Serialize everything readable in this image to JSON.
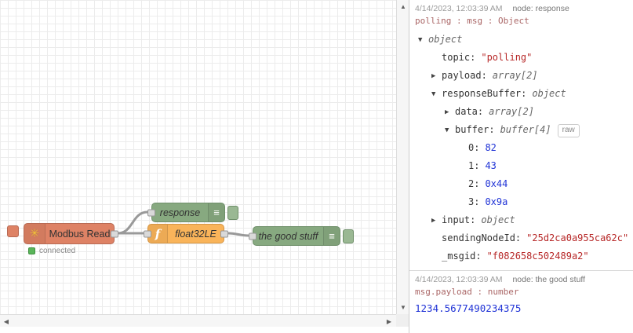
{
  "colors": {
    "modbus_node": "#de8265",
    "debug_node": "#87a980",
    "function_node": "#f9b45a",
    "string_value": "#b72828",
    "number_value": "#2033d6",
    "wire": "#999999"
  },
  "canvas": {
    "modbus": {
      "label": "Modbus Read",
      "status": "connected"
    },
    "response": {
      "label": "response"
    },
    "func": {
      "label": "float32LE",
      "icon": "f"
    },
    "good": {
      "label": "the good stuff"
    },
    "burger_icon": "≡",
    "gear_icon": "✳"
  },
  "debug": {
    "raw_button": "raw",
    "entry1": {
      "timestamp": "4/14/2023, 12:03:39 AM",
      "node": "node: response",
      "path": "polling : msg : Object",
      "rows": [
        {
          "indent": 0,
          "arrow": "▼",
          "key": "object",
          "key_class": "type"
        },
        {
          "indent": 1,
          "arrow": "",
          "key": "topic:",
          "value": "\"polling\"",
          "value_class": "string"
        },
        {
          "indent": 1,
          "arrow": "▶",
          "key": "payload:",
          "value": "array[2]",
          "value_class": "type"
        },
        {
          "indent": 1,
          "arrow": "▼",
          "key": "responseBuffer:",
          "value": "object",
          "value_class": "type"
        },
        {
          "indent": 2,
          "arrow": "▶",
          "key": "data:",
          "value": "array[2]",
          "value_class": "type"
        },
        {
          "indent": 2,
          "arrow": "▼",
          "key": "buffer:",
          "value": "buffer[4]",
          "value_class": "type",
          "raw": true
        },
        {
          "indent": 3,
          "arrow": "",
          "key": "0:",
          "value": "82",
          "value_class": "number"
        },
        {
          "indent": 3,
          "arrow": "",
          "key": "1:",
          "value": "43",
          "value_class": "number"
        },
        {
          "indent": 3,
          "arrow": "",
          "key": "2:",
          "value": "0x44",
          "value_class": "number"
        },
        {
          "indent": 3,
          "arrow": "",
          "key": "3:",
          "value": "0x9a",
          "value_class": "number"
        },
        {
          "indent": 1,
          "arrow": "▶",
          "key": "input:",
          "value": "object",
          "value_class": "type"
        },
        {
          "indent": 1,
          "arrow": "",
          "key": "sendingNodeId:",
          "value": "\"25d2ca0a955ca62c\"",
          "value_class": "string"
        },
        {
          "indent": 1,
          "arrow": "",
          "key": "_msgid:",
          "value": "\"f082658c502489a2\"",
          "value_class": "string"
        }
      ]
    },
    "entry2": {
      "timestamp": "4/14/2023, 12:03:39 AM",
      "node": "node: the good stuff",
      "path": "msg.payload : number",
      "value": "1234.5677490234375"
    }
  }
}
